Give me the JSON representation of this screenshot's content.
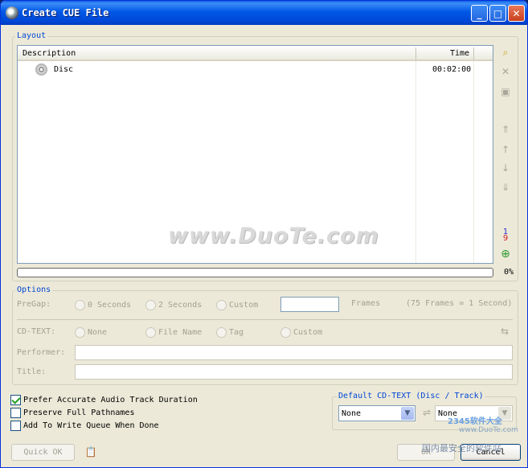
{
  "window": {
    "title": "Create CUE File"
  },
  "layout": {
    "legend": "Layout",
    "columns": {
      "description": "Description",
      "time": "Time"
    },
    "rows": [
      {
        "description": "Disc",
        "time": "00:02:00"
      }
    ],
    "progress_percent": "0%"
  },
  "options": {
    "legend": "Options",
    "pregap": {
      "label": "PreGap:",
      "opt1": "0 Seconds",
      "opt2": "2 Seconds",
      "opt3": "Custom",
      "frames_label": "Frames",
      "frames_note": "(75 Frames = 1 Second)",
      "value": ""
    },
    "cdtext": {
      "label": "CD-TEXT:",
      "opt1": "None",
      "opt2": "File Name",
      "opt3": "Tag",
      "opt4": "Custom"
    },
    "performer": {
      "label": "Performer:",
      "value": ""
    },
    "title": {
      "label": "Title:",
      "value": ""
    }
  },
  "checkboxes": {
    "accurate": {
      "label": "Prefer Accurate Audio Track Duration",
      "checked": true
    },
    "pathnames": {
      "label": "Preserve Full Pathnames",
      "checked": false
    },
    "queue": {
      "label": "Add To Write Queue When Done",
      "checked": false
    }
  },
  "default_cdtext": {
    "legend": "Default CD-TEXT (Disc / Track)",
    "disc_value": "None",
    "track_value": "None"
  },
  "buttons": {
    "quick_ok": "Quick OK",
    "ok": "OK",
    "cancel": "Cancel"
  },
  "watermark": {
    "main": "www.DuoTe.com",
    "corner_top": "2345软件大全",
    "corner_url": "www.DuoTe.com",
    "corner_bottom": "国内最安全的软件站"
  },
  "icons": {
    "title": "cd-disc-icon",
    "side": [
      "add-files-icon",
      "delete-icon",
      "properties-icon",
      "move-top-icon",
      "move-up-icon",
      "move-down-icon",
      "move-bottom-icon",
      "sort-icon",
      "add-disc-icon"
    ]
  }
}
